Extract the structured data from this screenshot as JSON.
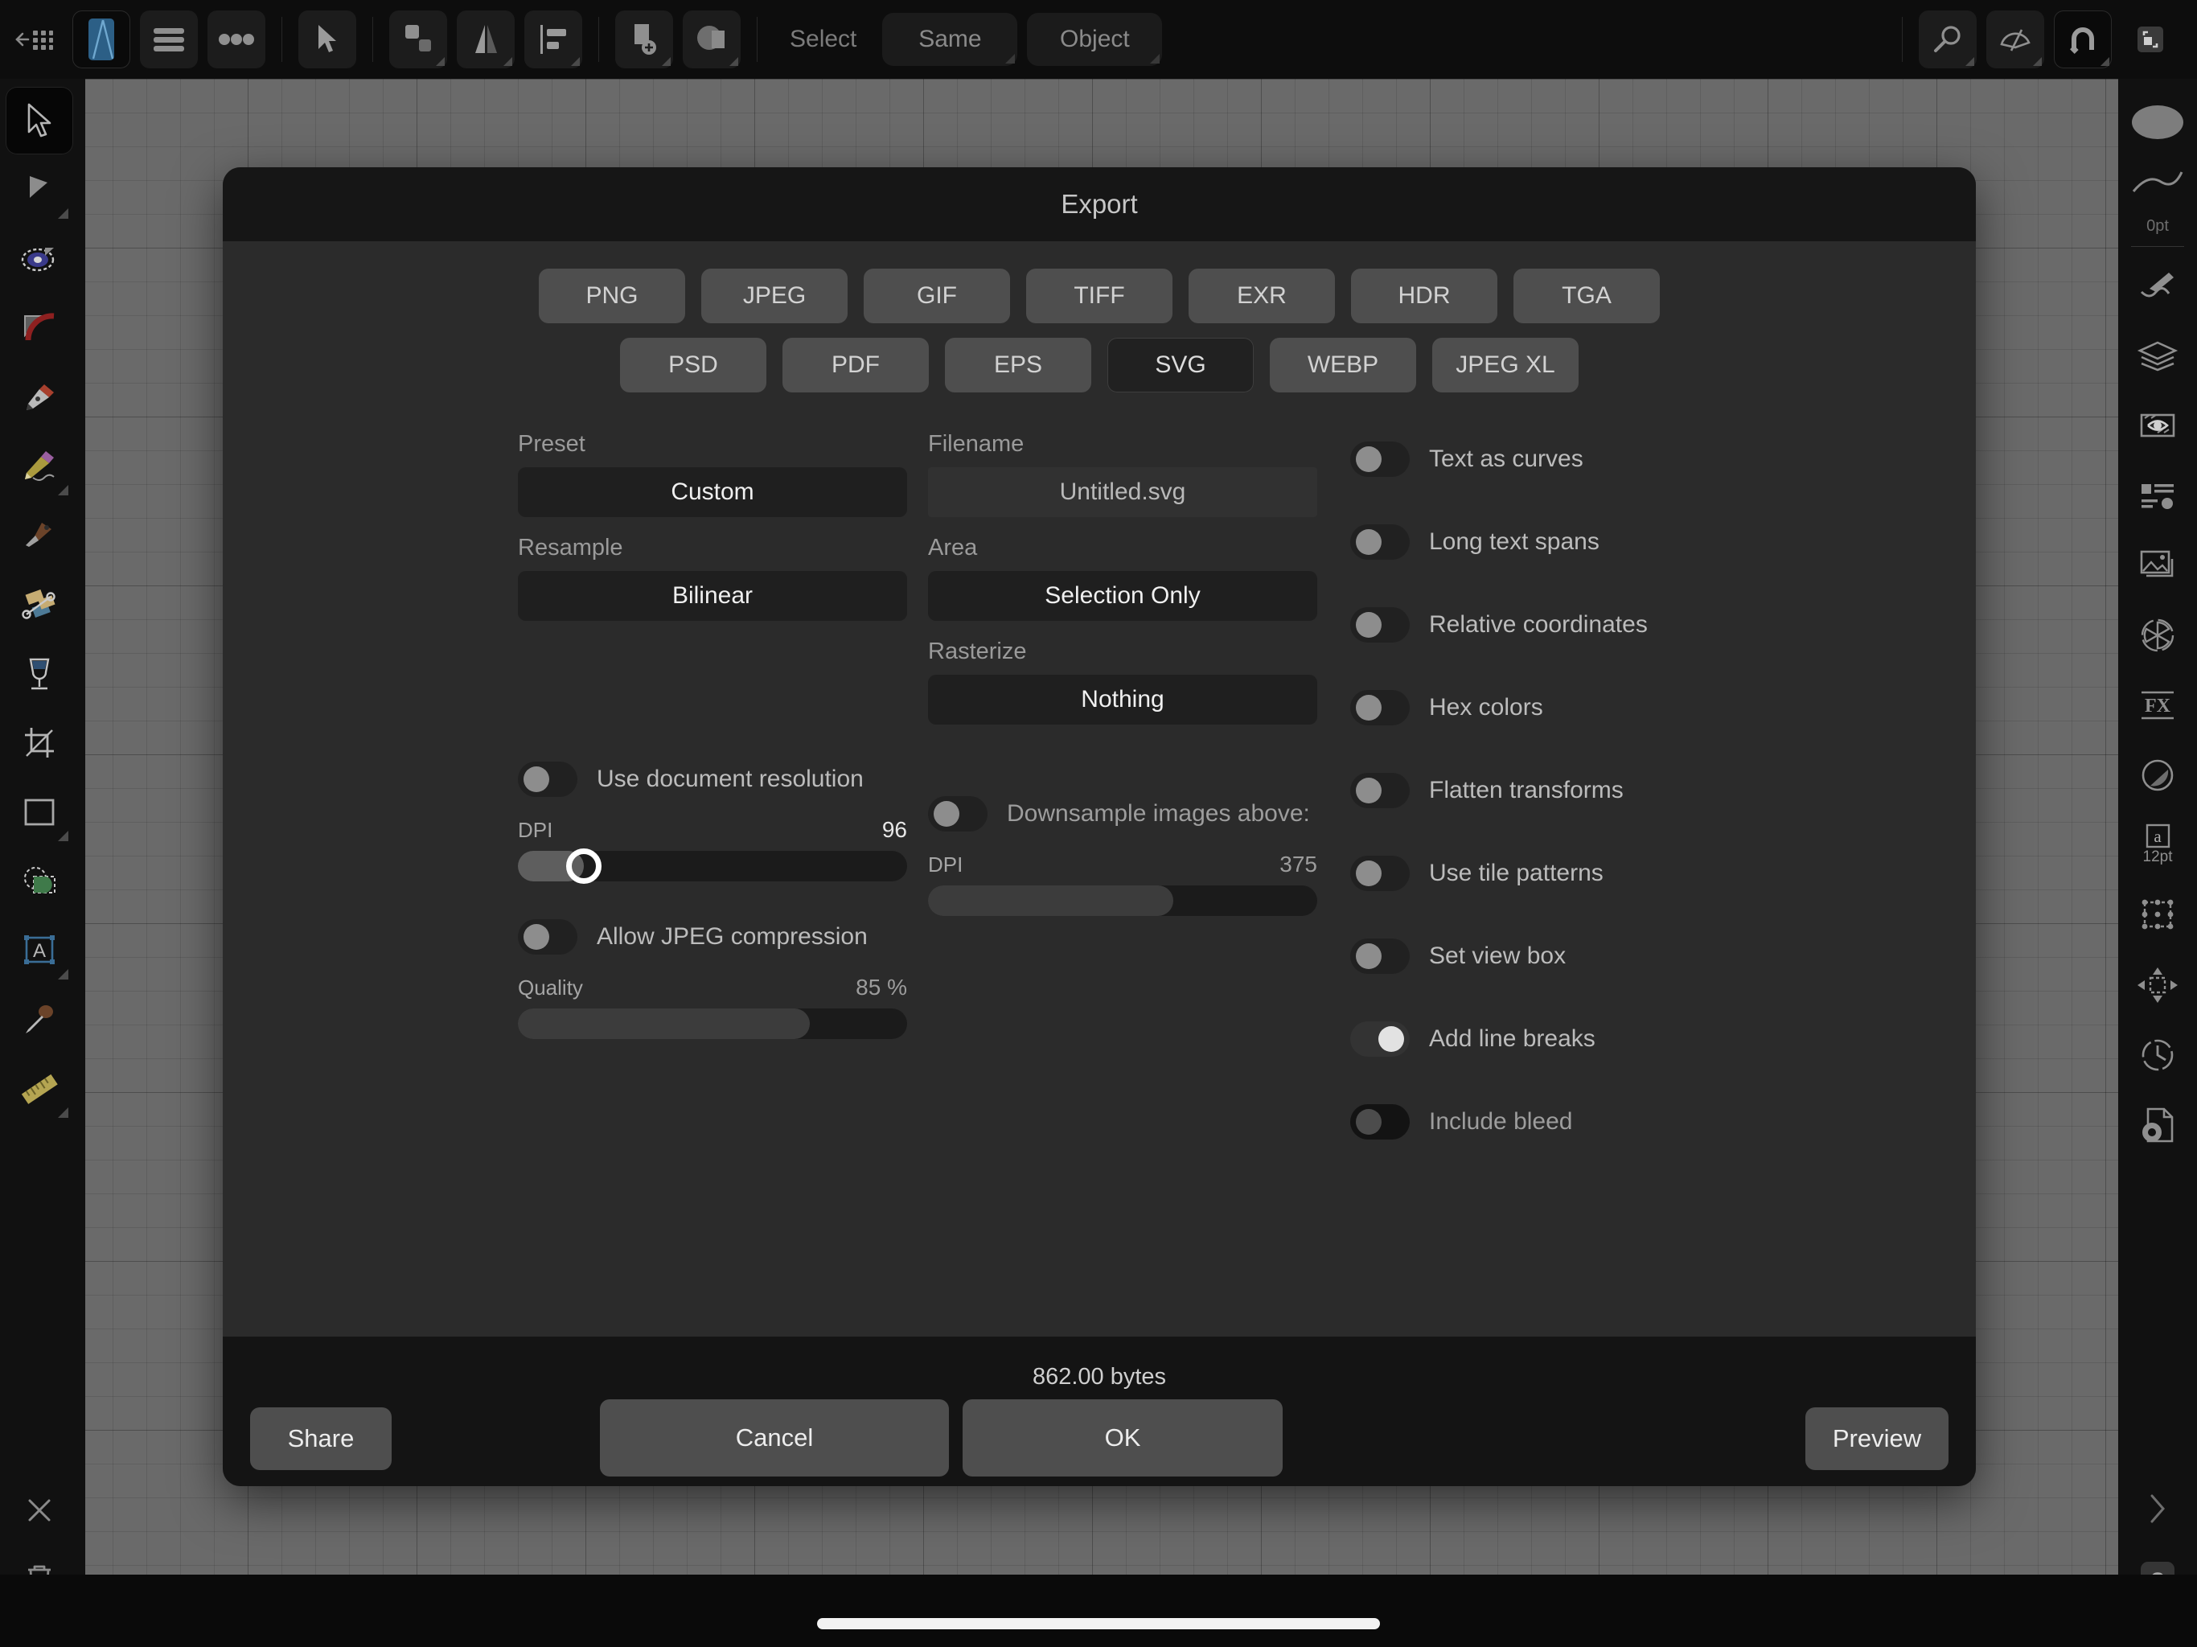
{
  "toolbar": {
    "back_icon": "back-grid-icon",
    "app_icon": "app-logo-icon",
    "menu_icon": "hamburger-menu-icon",
    "more_icon": "more-dots-icon",
    "tools": [
      {
        "name": "arrow-cursor-icon",
        "has_corner": false
      },
      {
        "name": "duplicate-shapes-icon",
        "has_corner": true
      },
      {
        "name": "flip-mirror-icon",
        "has_corner": true
      },
      {
        "name": "align-left-icon",
        "has_corner": true
      },
      {
        "name": "add-shape-icon",
        "has_corner": true
      },
      {
        "name": "boolean-merge-icon",
        "has_corner": true
      }
    ],
    "select_label": "Select",
    "same_label": "Same",
    "object_label": "Object",
    "right_tools": [
      {
        "name": "zoom-magnifier-icon",
        "active": false
      },
      {
        "name": "color-picker-wheel-icon",
        "active": false
      },
      {
        "name": "magnet-snap-icon",
        "active": true
      }
    ],
    "fullscreen_icon": "fullscreen-expand-icon"
  },
  "left_rail": {
    "tools": [
      {
        "name": "move-select-tool",
        "label": "Move",
        "active": true,
        "corner": false
      },
      {
        "name": "node-tool",
        "label": "Node",
        "active": false,
        "corner": true
      },
      {
        "name": "ellipse-select-tool",
        "label": "Ellipse select",
        "active": false,
        "corner": true
      },
      {
        "name": "corner-tool",
        "label": "Corner",
        "active": false,
        "corner": false
      },
      {
        "name": "pen-tool",
        "label": "Pen",
        "active": false,
        "corner": false
      },
      {
        "name": "pencil-tool",
        "label": "Pencil",
        "active": false,
        "corner": true
      },
      {
        "name": "knife-tool",
        "label": "Knife",
        "active": false,
        "corner": false
      },
      {
        "name": "gradient-tool",
        "label": "Gradient",
        "active": false,
        "corner": false
      },
      {
        "name": "fill-flood-tool",
        "label": "Fill",
        "active": false,
        "corner": false
      },
      {
        "name": "crop-tool",
        "label": "Crop",
        "active": false,
        "corner": false
      },
      {
        "name": "rectangle-tool",
        "label": "Rectangle",
        "active": false,
        "corner": true
      },
      {
        "name": "selection-transform-tool",
        "label": "Selection",
        "active": false,
        "corner": false
      },
      {
        "name": "text-frame-tool",
        "label": "Text",
        "active": false,
        "corner": true
      },
      {
        "name": "eyedropper-tool",
        "label": "Colour picker",
        "active": false,
        "corner": false
      },
      {
        "name": "ruler-tool",
        "label": "Measure",
        "active": false,
        "corner": true
      }
    ],
    "close_icon": "close-x-icon",
    "delete_icon": "trash-can-icon"
  },
  "right_rail": {
    "stroke_width_label": "0pt",
    "text_size_label": "12pt",
    "fx_label": "FX",
    "items": [
      {
        "name": "colour-swatch",
        "label": "Colour"
      },
      {
        "name": "stroke-curve",
        "label": "Stroke"
      },
      {
        "name": "brush-panel",
        "label": "Brushes"
      },
      {
        "name": "layers-panel",
        "label": "Layers"
      },
      {
        "name": "effects-eye-panel",
        "label": "Effects"
      },
      {
        "name": "text-style-panel",
        "label": "Text styles"
      },
      {
        "name": "image-panel",
        "label": "Image"
      },
      {
        "name": "colour-wheel-panel",
        "label": "Colour wheel"
      },
      {
        "name": "fx-panel",
        "label": "FX"
      },
      {
        "name": "adjustment-panel",
        "label": "Adjustment"
      },
      {
        "name": "character-panel",
        "label": "Character"
      },
      {
        "name": "transform-panel",
        "label": "Transform"
      },
      {
        "name": "align-move-panel",
        "label": "Align"
      },
      {
        "name": "history-panel",
        "label": "History"
      },
      {
        "name": "document-settings-panel",
        "label": "Document setup"
      }
    ],
    "chevron_icon": "chevron-right-icon",
    "help_label": "?"
  },
  "dialog": {
    "title": "Export",
    "formats": {
      "row1": [
        "PNG",
        "JPEG",
        "GIF",
        "TIFF",
        "EXR",
        "HDR",
        "TGA"
      ],
      "row2": [
        "PSD",
        "PDF",
        "EPS",
        "SVG",
        "WEBP",
        "JPEG XL"
      ],
      "selected": "SVG"
    },
    "preset": {
      "label": "Preset",
      "value": "Custom"
    },
    "resample": {
      "label": "Resample",
      "value": "Bilinear"
    },
    "filename": {
      "label": "Filename",
      "value": "Untitled.svg"
    },
    "area": {
      "label": "Area",
      "value": "Selection Only"
    },
    "rasterize": {
      "label": "Rasterize",
      "value": "Nothing"
    },
    "use_document_resolution": {
      "label": "Use document resolution",
      "on": false
    },
    "dpi_left": {
      "label": "DPI",
      "value": "96",
      "percent": 17
    },
    "downsample_images_above": {
      "label": "Downsample images above:",
      "on": false
    },
    "dpi_right": {
      "label": "DPI",
      "value": "375",
      "percent": 63
    },
    "allow_jpeg_compression": {
      "label": "Allow JPEG compression",
      "on": false
    },
    "quality": {
      "label": "Quality",
      "value": "85 %",
      "percent": 75
    },
    "options": [
      {
        "label": "Text as curves",
        "on": false,
        "disabled": false
      },
      {
        "label": "Long text spans",
        "on": false,
        "disabled": false
      },
      {
        "label": "Relative coordinates",
        "on": false,
        "disabled": false
      },
      {
        "label": "Hex colors",
        "on": false,
        "disabled": false
      },
      {
        "label": "Flatten transforms",
        "on": false,
        "disabled": false
      },
      {
        "label": "Use tile patterns",
        "on": false,
        "disabled": false
      },
      {
        "label": "Set view box",
        "on": false,
        "disabled": false
      },
      {
        "label": "Add line breaks",
        "on": true,
        "disabled": false
      },
      {
        "label": "Include bleed",
        "on": false,
        "disabled": true
      }
    ],
    "file_size": "862.00 bytes",
    "share_label": "Share",
    "cancel_label": "Cancel",
    "ok_label": "OK",
    "preview_label": "Preview"
  },
  "colors": {
    "dialog_bg": "#2b2b2b",
    "header_bg": "#161616",
    "footer_bg": "#141414",
    "button_bg": "#4e4e4e",
    "selected_bg": "#212121",
    "canvas_grid": "#6a6a6a",
    "toggle_on_knob": "#e2e2e2",
    "accent_line": "#2b2b42"
  }
}
